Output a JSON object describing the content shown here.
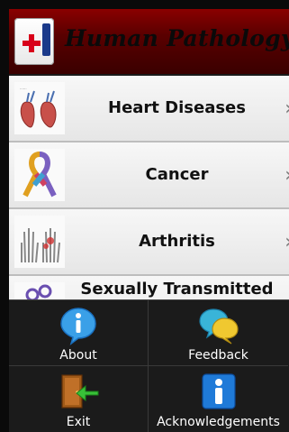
{
  "header": {
    "title": "Human Pathology"
  },
  "list": {
    "items": [
      {
        "label": "Heart Diseases",
        "icon": "heart-anatomy-thumbnail"
      },
      {
        "label": "Cancer",
        "icon": "cancer-ribbon-thumbnail"
      },
      {
        "label": "Arthritis",
        "icon": "hand-xray-thumbnail"
      },
      {
        "label": "Sexually Transmitted",
        "icon": "std-thumbnail"
      }
    ]
  },
  "menu": {
    "about": "About",
    "feedback": "Feedback",
    "exit": "Exit",
    "acknowledgements": "Acknowledgements"
  }
}
